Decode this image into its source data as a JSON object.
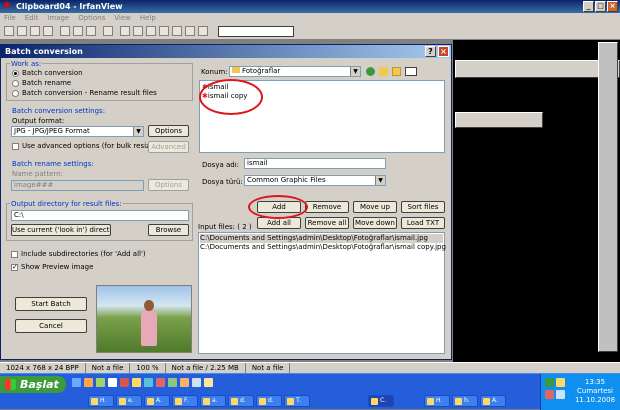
{
  "irfanview": {
    "title": "Clipboard04 - IrfanView",
    "menu": [
      "File",
      "Edit",
      "Image",
      "Options",
      "View",
      "Help"
    ],
    "status": [
      "1024 x 768 x 24 BPP",
      "Not a file",
      "100 %",
      "Not a file / 2.25 MB",
      "Not a file"
    ]
  },
  "dialog": {
    "title": "Batch conversion",
    "work_as": {
      "label": "Work as:",
      "options": [
        "Batch conversion",
        "Batch rename",
        "Batch conversion - Rename result files"
      ],
      "selected": 0
    },
    "conversion_settings": {
      "label": "Batch conversion settings:",
      "output_format_label": "Output format:",
      "output_format_value": "JPG - JPG/JPEG Format",
      "options_button": "Options",
      "advanced_checkbox": "Use advanced options (for bulk resize...)",
      "advanced_button": "Advanced"
    },
    "rename_settings": {
      "label": "Batch rename settings:",
      "name_pattern_label": "Name pattern:",
      "name_pattern_value": "image###",
      "options_button": "Options"
    },
    "output_dir": {
      "label": "Output directory for result files:",
      "value": "C:\\",
      "use_current_button": "Use current ('look in') directory",
      "browse_button": "Browse"
    },
    "include_subdirs": "Include subdirectories (for 'Add all')",
    "show_preview": "Show Preview image",
    "start_button": "Start Batch",
    "cancel_button": "Cancel",
    "konum_label": "Konum:",
    "konum_value": "Fotoğraflar",
    "files": [
      "ismail",
      "ismail copy"
    ],
    "dosya_adi_label": "Dosya adı:",
    "dosya_adi_value": "ismail",
    "dosya_turu_label": "Dosya türü:",
    "dosya_turu_value": "Common Graphic Files",
    "buttons": {
      "add": "Add",
      "remove": "Remove",
      "move_up": "Move up",
      "sort_files": "Sort files",
      "add_all": "Add all",
      "remove_all": "Remove all",
      "move_down": "Move down",
      "load_txt": "Load TXT"
    },
    "input_files_label": "Input files: ( 2 )",
    "input_files": [
      "C:\\Documents and Settings\\admin\\Desktop\\Fotoğraflar\\ismail.jpg",
      "C:\\Documents and Settings\\admin\\Desktop\\Fotoğraflar\\ismail copy.jpg"
    ]
  },
  "taskbar": {
    "start": "Başlat",
    "tasks": [
      "H.",
      "e.",
      "A.",
      "F.",
      "a.",
      "d.",
      "d.",
      "T.",
      "C.",
      "H.",
      "h.",
      "A."
    ],
    "active_task": 8,
    "clock_time": "13:35",
    "clock_day": "Cumartesi",
    "clock_date": "11.10.2008"
  },
  "icons": {
    "app": "irfanview-icon",
    "accent_red": "#e0141e",
    "title_blue": "#0a246a",
    "taskbar_blue": "#245edb"
  }
}
